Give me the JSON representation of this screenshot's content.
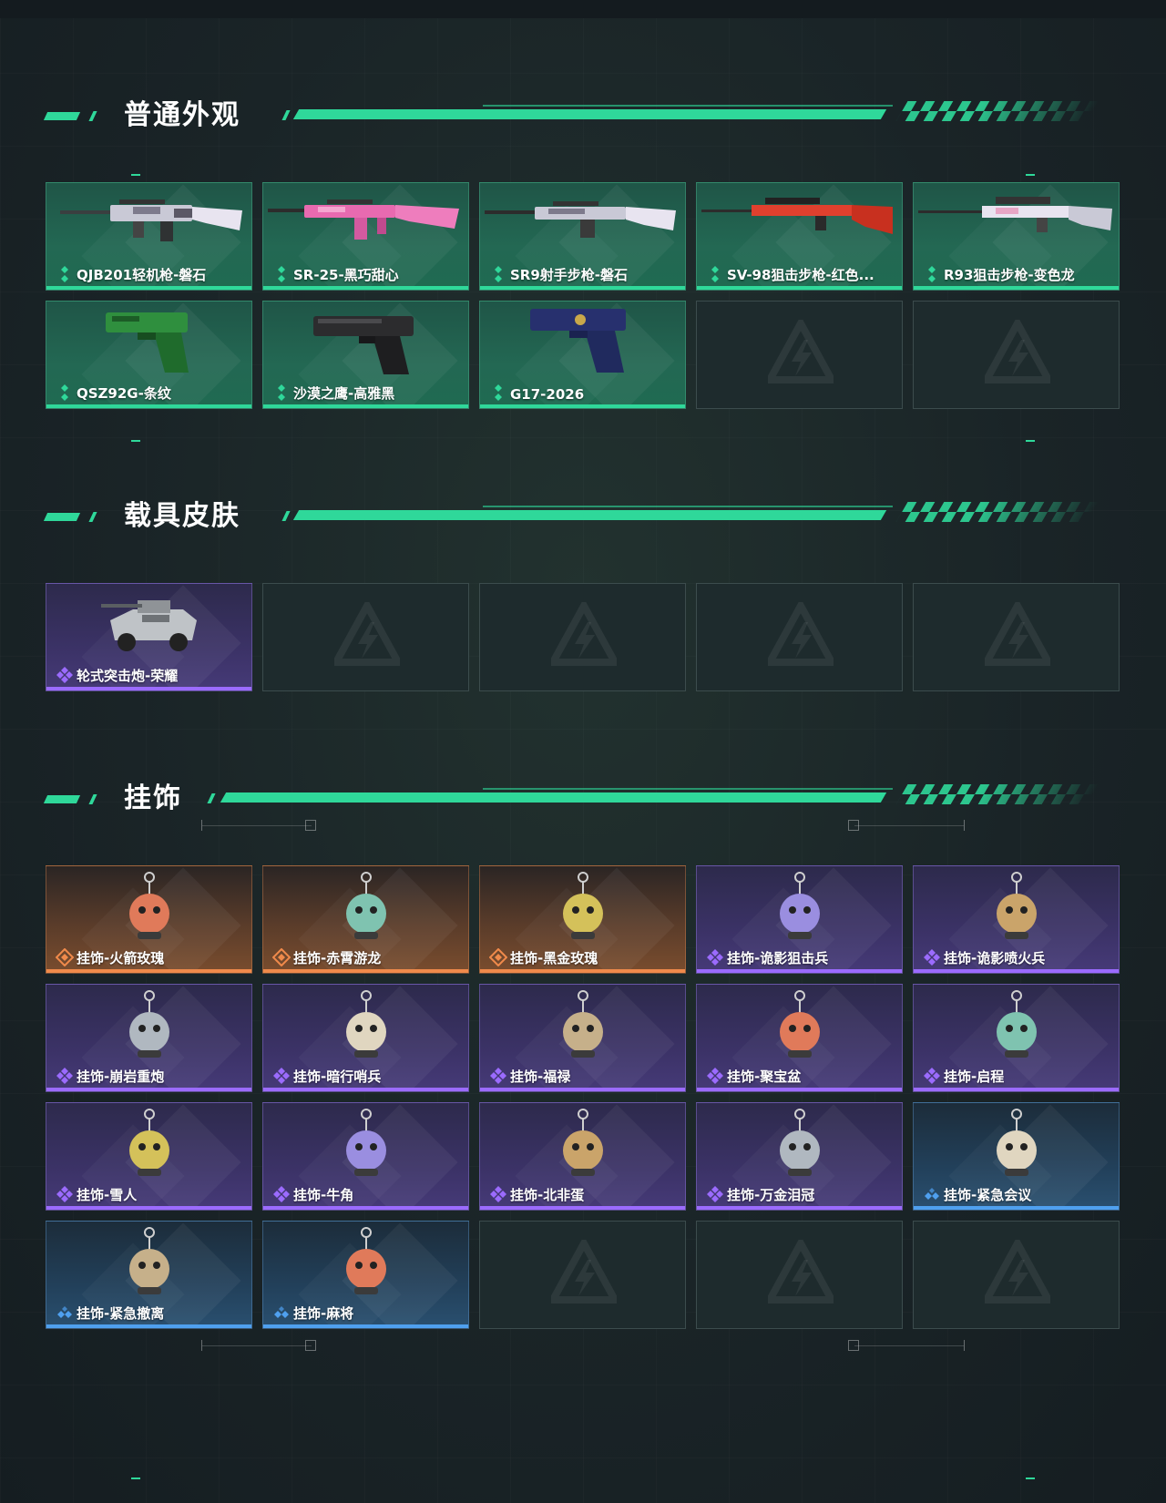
{
  "sections": [
    {
      "title": "普通外观",
      "items": [
        {
          "label": "QJB201轻机枪-磐石",
          "rarity": "green",
          "icon": "lmg-rifle-icon"
        },
        {
          "label": "SR-25-黑巧甜心",
          "rarity": "green",
          "icon": "pink-rifle-icon"
        },
        {
          "label": "SR9射手步枪-磐石",
          "rarity": "green",
          "icon": "marksman-rifle-icon"
        },
        {
          "label": "SV-98狙击步枪-红色...",
          "rarity": "green",
          "icon": "red-sniper-icon"
        },
        {
          "label": "R93狙击步枪-变色龙",
          "rarity": "green",
          "icon": "sniper-rifle-icon"
        },
        {
          "label": "QSZ92G-条纹",
          "rarity": "green",
          "icon": "pistol-icon"
        },
        {
          "label": "沙漠之鹰-高雅黑",
          "rarity": "green",
          "icon": "desert-eagle-icon"
        },
        {
          "label": "G17-2026",
          "rarity": "green",
          "icon": "glock-icon"
        }
      ]
    },
    {
      "title": "载具皮肤",
      "items": [
        {
          "label": "轮式突击炮-荣耀",
          "rarity": "purple",
          "icon": "armored-vehicle-icon"
        }
      ]
    },
    {
      "title": "挂饰",
      "items": [
        {
          "label": "挂饰-火箭玫瑰",
          "rarity": "orange",
          "icon": "charm-icon"
        },
        {
          "label": "挂饰-赤霄游龙",
          "rarity": "orange",
          "icon": "charm-icon"
        },
        {
          "label": "挂饰-黑金玫瑰",
          "rarity": "orange",
          "icon": "charm-icon"
        },
        {
          "label": "挂饰-诡影狙击兵",
          "rarity": "purple",
          "icon": "charm-icon"
        },
        {
          "label": "挂饰-诡影喷火兵",
          "rarity": "purple",
          "icon": "charm-icon"
        },
        {
          "label": "挂饰-崩岩重炮",
          "rarity": "purple",
          "icon": "charm-icon"
        },
        {
          "label": "挂饰-暗行哨兵",
          "rarity": "purple",
          "icon": "charm-icon"
        },
        {
          "label": "挂饰-福禄",
          "rarity": "purple",
          "icon": "charm-icon"
        },
        {
          "label": "挂饰-聚宝盆",
          "rarity": "purple",
          "icon": "charm-icon"
        },
        {
          "label": "挂饰-启程",
          "rarity": "purple",
          "icon": "charm-icon"
        },
        {
          "label": "挂饰-雪人",
          "rarity": "purple",
          "icon": "charm-icon"
        },
        {
          "label": "挂饰-牛角",
          "rarity": "purple",
          "icon": "charm-icon"
        },
        {
          "label": "挂饰-北非蛋",
          "rarity": "purple",
          "icon": "charm-icon"
        },
        {
          "label": "挂饰-万金泪冠",
          "rarity": "purple",
          "icon": "charm-icon"
        },
        {
          "label": "挂饰-紧急会议",
          "rarity": "blue",
          "icon": "charm-icon"
        },
        {
          "label": "挂饰-紧急撤离",
          "rarity": "blue",
          "icon": "charm-icon"
        },
        {
          "label": "挂饰-麻将",
          "rarity": "blue",
          "icon": "charm-icon"
        }
      ]
    }
  ],
  "colors": {
    "accent": "#2fd89a",
    "green": "#2fd89a",
    "purple": "#9b6bff",
    "orange": "#f08a4b",
    "blue": "#4fa0ef"
  }
}
